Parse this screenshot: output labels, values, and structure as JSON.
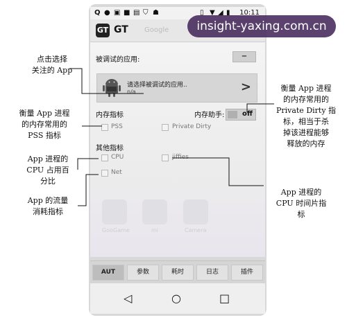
{
  "status_bar": {
    "time": "10:11",
    "left_icons": [
      "q-icon",
      "dot-icon",
      "image-icon",
      "square-icon",
      "sim-icon",
      "shield-icon",
      "android-icon"
    ],
    "right_icons": [
      "vibrate-icon",
      "wifi-icon",
      "signal-icon",
      "battery-icon"
    ]
  },
  "app_bar": {
    "logo_text": "GT",
    "title": "GT",
    "faded_title": "Google"
  },
  "aut": {
    "header": "被调试的应用:",
    "collapse_label": "−",
    "select_text": "请选择被调试的应用..",
    "select_sub": "n/a",
    "arrow": ">"
  },
  "memory": {
    "header": "内存指标",
    "helper_label": "内存助手:",
    "toggle_state": "off",
    "pss_label": "PSS",
    "private_dirty_label": "Private Dirty"
  },
  "other": {
    "header": "其他指标",
    "cpu_label": "CPU",
    "jiffies_label": "jiffies",
    "net_label": "Net"
  },
  "background_icons": [
    "GooGame",
    "mi",
    "Camera"
  ],
  "tabs": [
    {
      "label": "AUT",
      "active": true
    },
    {
      "label": "参数",
      "active": false
    },
    {
      "label": "耗时",
      "active": false
    },
    {
      "label": "日志",
      "active": false
    },
    {
      "label": "插件",
      "active": false
    }
  ],
  "nav": {
    "back": "◁",
    "home": "○",
    "recent": "□"
  },
  "annotations": {
    "a1": "点击选择\n关注的 App",
    "a2": "衡量 App 进程\n的内存常用的\nPSS 指标",
    "a3": "App 进程的\nCPU 占用百\n分比",
    "a4": "App 的流量\n消耗指标",
    "a5": "衡量 App 进程\n的内存常用的\nPrivate Dirty 指\n标，相当于杀\n掉该进程能够\n释放的内存",
    "a6": "App 进程的\nCPU 时间片指\n标"
  },
  "watermark": "insight-yaxing.com.cn",
  "colors": {
    "watermark_bg": "#46285a",
    "active_tab": "#bdbdbd"
  }
}
